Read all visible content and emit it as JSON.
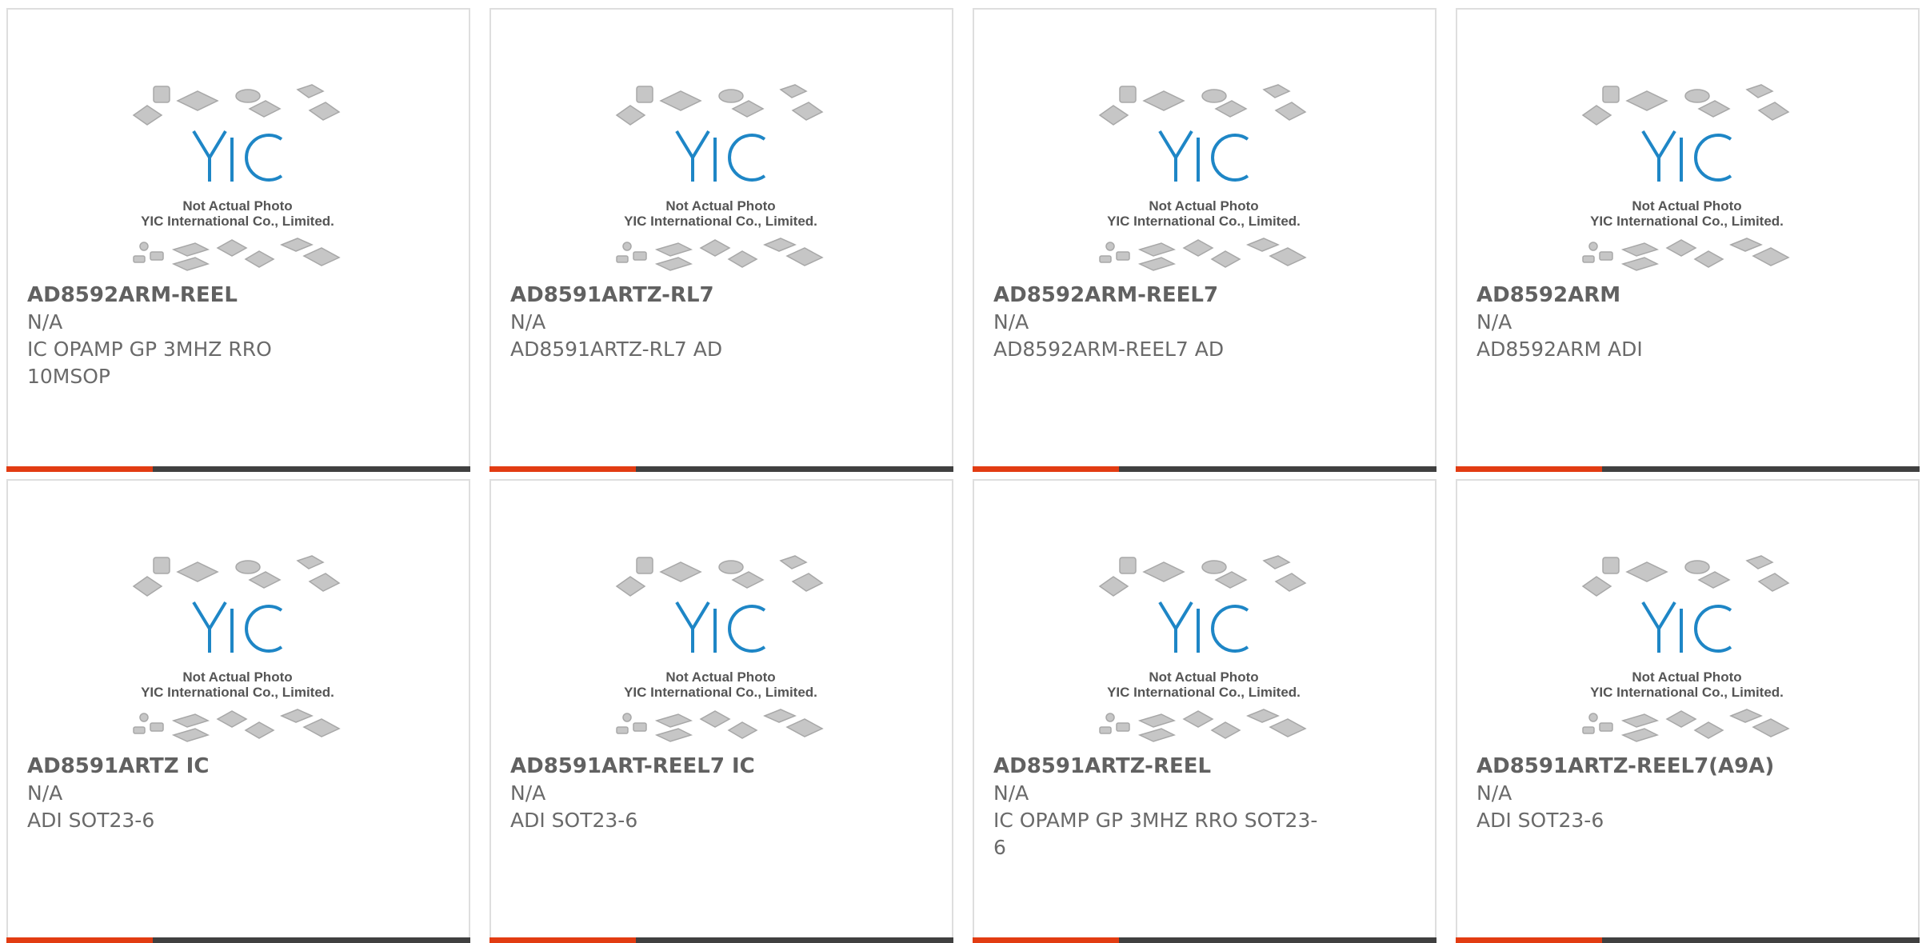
{
  "placeholder": {
    "line1": "Not Actual Photo",
    "line2": "YIC International Co., Limited.",
    "logo_text": "YIC"
  },
  "colors": {
    "accent": "#e23c12",
    "bar": "#404040",
    "logo": "#1e86c6"
  },
  "products": [
    {
      "part_number": "AD8592ARM-REEL",
      "manufacturer": "N/A",
      "description": "IC OPAMP GP 3MHZ RRO 10MSOP"
    },
    {
      "part_number": "AD8591ARTZ-RL7",
      "manufacturer": "N/A",
      "description": "AD8591ARTZ-RL7 AD"
    },
    {
      "part_number": "AD8592ARM-REEL7",
      "manufacturer": "N/A",
      "description": "AD8592ARM-REEL7 AD"
    },
    {
      "part_number": "AD8592ARM",
      "manufacturer": "N/A",
      "description": "AD8592ARM ADI"
    },
    {
      "part_number": "AD8591ARTZ IC",
      "manufacturer": "N/A",
      "description": "ADI SOT23-6"
    },
    {
      "part_number": "AD8591ART-REEL7 IC",
      "manufacturer": "N/A",
      "description": "ADI SOT23-6"
    },
    {
      "part_number": "AD8591ARTZ-REEL",
      "manufacturer": "N/A",
      "description": "IC OPAMP GP 3MHZ RRO SOT23-6"
    },
    {
      "part_number": "AD8591ARTZ-REEL7(A9A)",
      "manufacturer": "N/A",
      "description": "ADI SOT23-6"
    }
  ]
}
